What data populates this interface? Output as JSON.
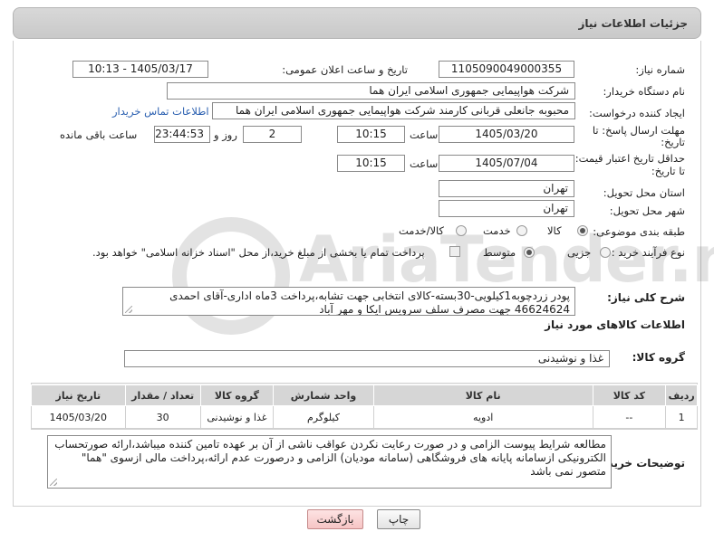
{
  "page": {
    "title": "جزئیات اطلاعات نیاز"
  },
  "fields": {
    "need_number": {
      "label": "شماره نیاز:",
      "value": "1105090049000355"
    },
    "announce_datetime": {
      "label": "تاریخ و ساعت اعلان عمومی:",
      "value": "1405/03/17 - 10:13"
    },
    "buyer_org": {
      "label": "نام دستگاه خریدار:",
      "value": "شرکت هواپیمایی جمهوری اسلامی ایران هما"
    },
    "requester": {
      "label": "ایجاد کننده درخواست:",
      "value": "محبوبه جانعلی قربانی کارمند شرکت هواپیمایی جمهوری اسلامی ایران هما",
      "contact_link": "اطلاعات تماس خریدار"
    },
    "reply_deadline": {
      "label_line1": "مهلت ارسال پاسخ: تا",
      "label_line2": "تاریخ:",
      "date": "1405/03/20",
      "time_label": "ساعت",
      "time": "10:15",
      "days": "2",
      "days_label": "روز و",
      "remaining": "23:44:53",
      "remaining_label": "ساعت باقی مانده"
    },
    "price_validity": {
      "label_line1": "حداقل تاریخ اعتبار قیمت:",
      "label_line2": "تا تاریخ:",
      "date": "1405/07/04",
      "time_label": "ساعت",
      "time": "10:15"
    },
    "delivery_province": {
      "label": "استان محل تحویل:",
      "value": "تهران"
    },
    "delivery_city": {
      "label": "شهر محل تحویل:",
      "value": "تهران"
    },
    "category": {
      "label": "طبقه بندی موضوعی:",
      "options": [
        "کالا",
        "خدمت",
        "کالا/خدمت"
      ],
      "selected": "کالا"
    },
    "process_type": {
      "label": "نوع فرآیند خرید :",
      "options": [
        "جزیی",
        "متوسط"
      ],
      "selected": "متوسط",
      "treasury_note": "پرداخت تمام یا بخشی از مبلغ خرید،از محل \"اسناد خزانه اسلامی\" خواهد بود."
    }
  },
  "description": {
    "label": "شرح کلی نیاز:",
    "value": "پودر زردچوبه1کیلویی-30بسته-کالای انتخابی جهت تشابه،پرداخت 3ماه اداری-آقای احمدی 46624624 جهت مصرف سلف سرویس ایکا و مهر آباد"
  },
  "goods_info": {
    "heading": "اطلاعات کالاهای مورد نیاز",
    "group_label": "گروه کالا:",
    "group_value": "غذا و نوشیدنی"
  },
  "table": {
    "headers": [
      "ردیف",
      "کد کالا",
      "نام کالا",
      "واحد شمارش",
      "گروه کالا",
      "تعداد / مقدار",
      "تاریخ نیاز"
    ],
    "rows": [
      [
        "1",
        "--",
        "ادویه",
        "کیلوگرم",
        "غذا و نوشیدنی",
        "30",
        "1405/03/20"
      ]
    ]
  },
  "buyer_notes": {
    "label": "توضیحات خریدار:",
    "value": "مطالعه شرایط پیوست الزامی و در صورت رعایت نکردن عواقب ناشی از آن بر عهده تامین کننده میباشد،ارائه صورتحساب الکترونیکی ازسامانه پایانه های فروشگاهی (سامانه مودیان) الزامی و درصورت عدم ارائه،پرداخت مالی ازسوی \"هما\" متصور نمی باشد"
  },
  "buttons": {
    "print": "چاپ",
    "back": "بازگشت"
  },
  "colors": {
    "header_bg": "#cccccc",
    "link": "#2a5fb0",
    "back_button": "#f6c5c5"
  }
}
